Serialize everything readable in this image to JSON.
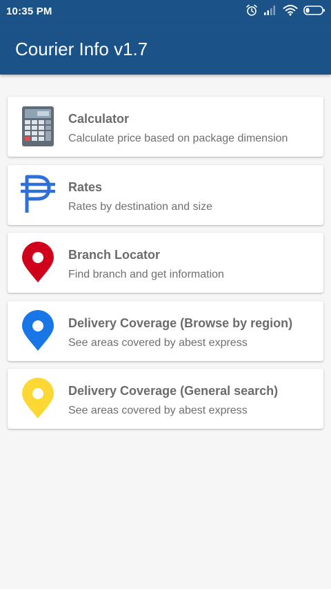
{
  "status_bar": {
    "time": "10:35 PM",
    "icons": [
      "alarm-icon",
      "signal-icon",
      "wifi-icon",
      "battery-icon"
    ]
  },
  "app_bar": {
    "title": "Courier Info v1.7",
    "color": "#1b5389"
  },
  "menu": {
    "items": [
      {
        "title": "Calculator",
        "subtitle": "Calculate price based on package dimension",
        "icon": "calculator-icon"
      },
      {
        "title": "Rates",
        "subtitle": "Rates by destination and size",
        "icon": "peso-icon",
        "icon_color": "#2f6fd9"
      },
      {
        "title": "Branch Locator",
        "subtitle": "Find branch and get information",
        "icon": "map-pin-icon",
        "icon_color": "#d0021b"
      },
      {
        "title": "Delivery Coverage (Browse by region)",
        "subtitle": "See areas covered by abest express",
        "icon": "map-pin-icon",
        "icon_color": "#1976e6"
      },
      {
        "title": "Delivery Coverage (General search)",
        "subtitle": "See areas covered by abest express",
        "icon": "map-pin-icon",
        "icon_color": "#fdd835"
      }
    ]
  }
}
